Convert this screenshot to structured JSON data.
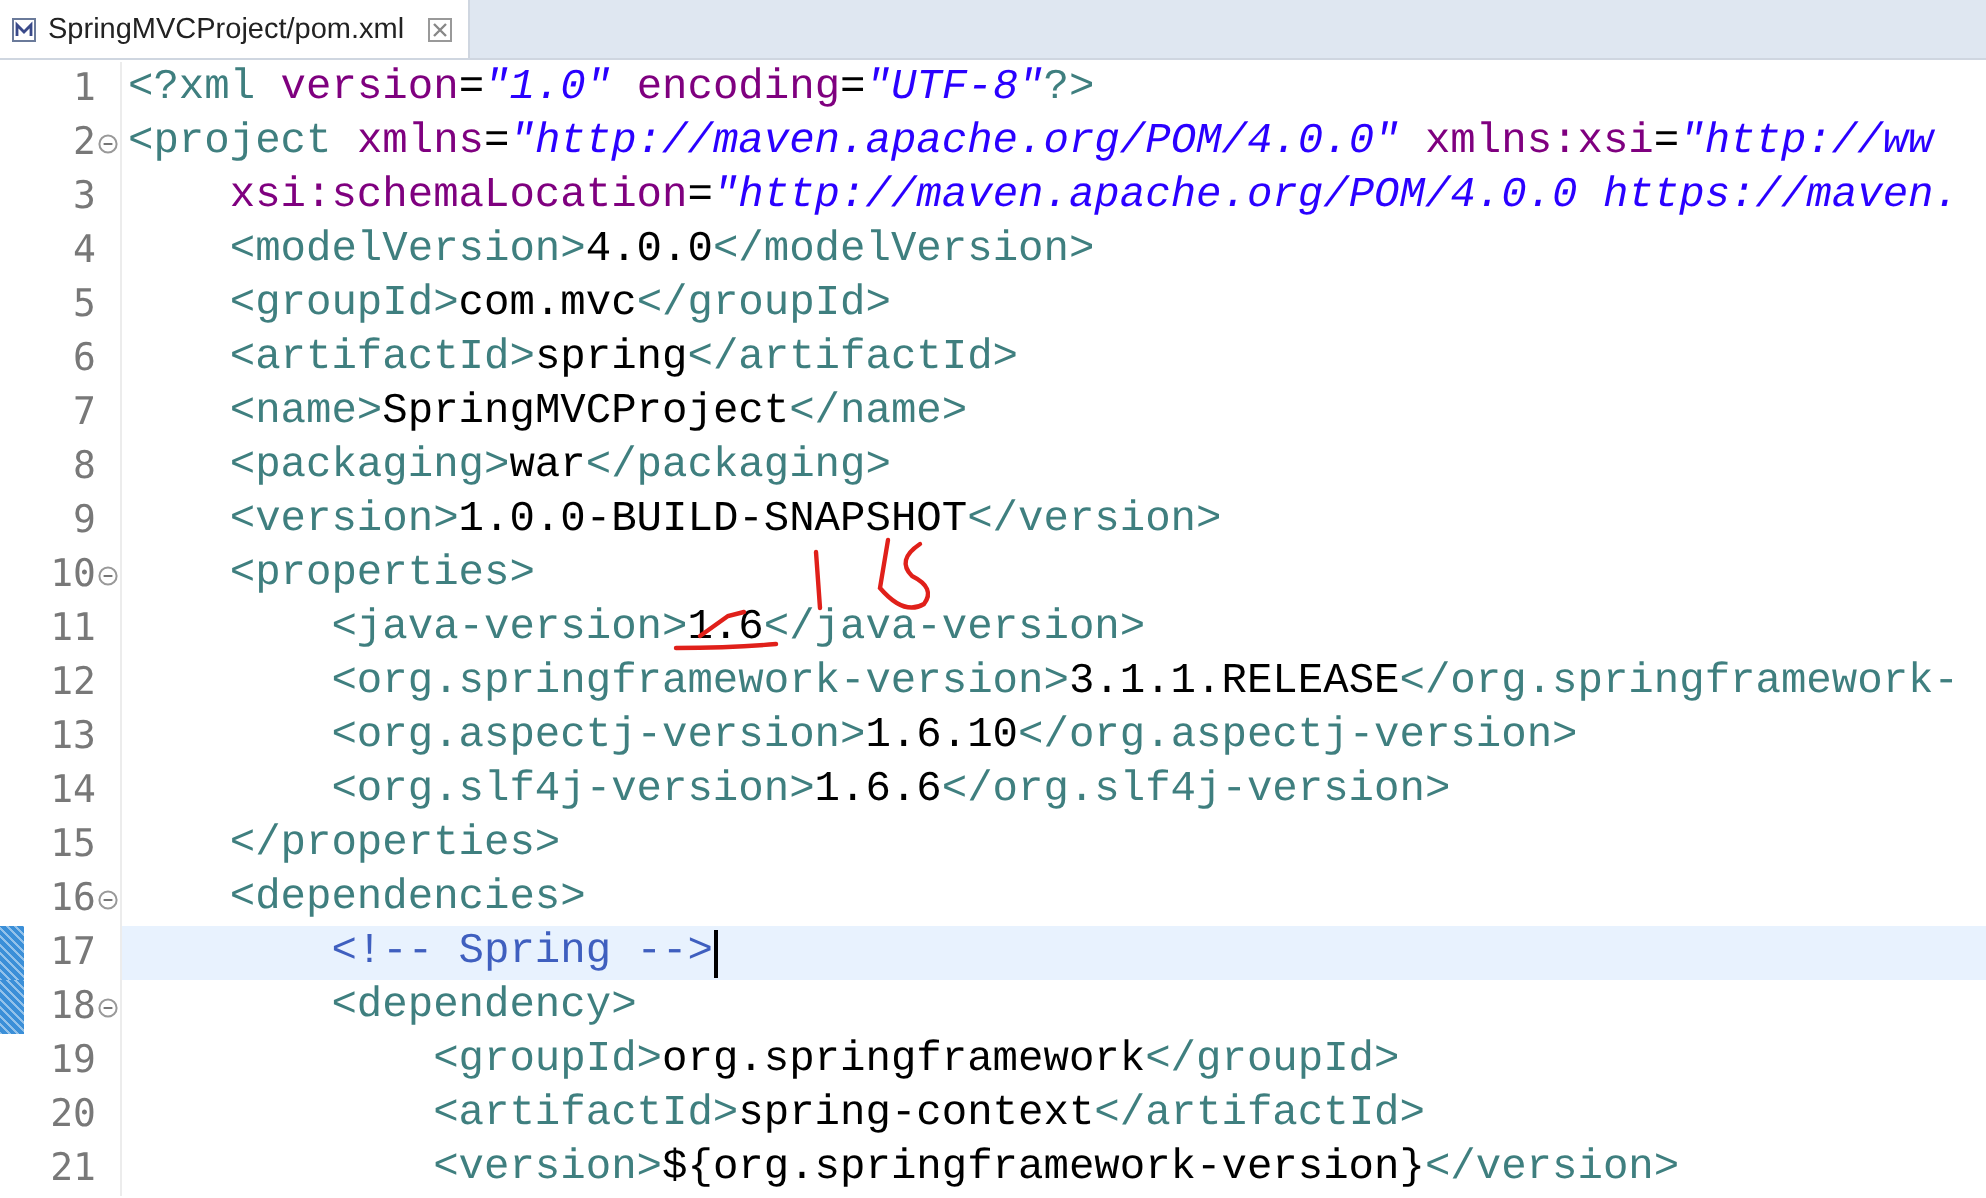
{
  "editor_tab": {
    "title": "SpringMVCProject/pom.xml",
    "selected": true
  },
  "lines": [
    {
      "number": "1",
      "fold": false,
      "current": false,
      "changed": false,
      "tokens": [
        {
          "kind": "tag",
          "text": "<?xml "
        },
        {
          "kind": "attr",
          "text": "version"
        },
        {
          "kind": "eq",
          "text": "="
        },
        {
          "kind": "value",
          "text": "\"1.0\" "
        },
        {
          "kind": "attr",
          "text": "encoding"
        },
        {
          "kind": "eq",
          "text": "="
        },
        {
          "kind": "value",
          "text": "\"UTF-8\""
        },
        {
          "kind": "tag",
          "text": "?>"
        }
      ]
    },
    {
      "number": "2",
      "fold": true,
      "current": false,
      "changed": false,
      "tokens": [
        {
          "kind": "tag",
          "text": "<project "
        },
        {
          "kind": "attr",
          "text": "xmlns"
        },
        {
          "kind": "eq",
          "text": "="
        },
        {
          "kind": "value",
          "text": "\"http://maven.apache.org/POM/4.0.0\" "
        },
        {
          "kind": "attr",
          "text": "xmlns:xsi"
        },
        {
          "kind": "eq",
          "text": "="
        },
        {
          "kind": "value",
          "text": "\"http://ww"
        }
      ]
    },
    {
      "number": "3",
      "fold": false,
      "current": false,
      "changed": false,
      "tokens": [
        {
          "kind": "attr",
          "text": "    xsi:schemaLocation"
        },
        {
          "kind": "eq",
          "text": "="
        },
        {
          "kind": "value",
          "text": "\"http://maven.apache.org/POM/4.0.0 https://maven."
        }
      ]
    },
    {
      "number": "4",
      "fold": false,
      "current": false,
      "changed": false,
      "tokens": [
        {
          "kind": "tag",
          "text": "    <modelVersion>"
        },
        {
          "kind": "text",
          "text": "4.0.0"
        },
        {
          "kind": "tag",
          "text": "</modelVersion>"
        }
      ]
    },
    {
      "number": "5",
      "fold": false,
      "current": false,
      "changed": false,
      "tokens": [
        {
          "kind": "tag",
          "text": "    <groupId>"
        },
        {
          "kind": "text",
          "text": "com.mvc"
        },
        {
          "kind": "tag",
          "text": "</groupId>"
        }
      ]
    },
    {
      "number": "6",
      "fold": false,
      "current": false,
      "changed": false,
      "tokens": [
        {
          "kind": "tag",
          "text": "    <artifactId>"
        },
        {
          "kind": "text",
          "text": "spring"
        },
        {
          "kind": "tag",
          "text": "</artifactId>"
        }
      ]
    },
    {
      "number": "7",
      "fold": false,
      "current": false,
      "changed": false,
      "tokens": [
        {
          "kind": "tag",
          "text": "    <name>"
        },
        {
          "kind": "text",
          "text": "SpringMVCProject"
        },
        {
          "kind": "tag",
          "text": "</name>"
        }
      ]
    },
    {
      "number": "8",
      "fold": false,
      "current": false,
      "changed": false,
      "tokens": [
        {
          "kind": "tag",
          "text": "    <packaging>"
        },
        {
          "kind": "text",
          "text": "war"
        },
        {
          "kind": "tag",
          "text": "</packaging>"
        }
      ]
    },
    {
      "number": "9",
      "fold": false,
      "current": false,
      "changed": false,
      "tokens": [
        {
          "kind": "tag",
          "text": "    <version>"
        },
        {
          "kind": "text",
          "text": "1.0.0-BUILD-SNAPSHOT"
        },
        {
          "kind": "tag",
          "text": "</version>"
        }
      ]
    },
    {
      "number": "10",
      "fold": true,
      "current": false,
      "changed": false,
      "tokens": [
        {
          "kind": "tag",
          "text": "    <properties>"
        }
      ]
    },
    {
      "number": "11",
      "fold": false,
      "current": false,
      "changed": false,
      "tokens": [
        {
          "kind": "tag",
          "text": "        <java-version>"
        },
        {
          "kind": "text",
          "text": "1.6"
        },
        {
          "kind": "tag",
          "text": "</java-version>"
        }
      ]
    },
    {
      "number": "12",
      "fold": false,
      "current": false,
      "changed": false,
      "tokens": [
        {
          "kind": "tag",
          "text": "        <org.springframework-version>"
        },
        {
          "kind": "text",
          "text": "3.1.1.RELEASE"
        },
        {
          "kind": "tag",
          "text": "</org.springframework-"
        }
      ]
    },
    {
      "number": "13",
      "fold": false,
      "current": false,
      "changed": false,
      "tokens": [
        {
          "kind": "tag",
          "text": "        <org.aspectj-version>"
        },
        {
          "kind": "text",
          "text": "1.6.10"
        },
        {
          "kind": "tag",
          "text": "</org.aspectj-version>"
        }
      ]
    },
    {
      "number": "14",
      "fold": false,
      "current": false,
      "changed": false,
      "tokens": [
        {
          "kind": "tag",
          "text": "        <org.slf4j-version>"
        },
        {
          "kind": "text",
          "text": "1.6.6"
        },
        {
          "kind": "tag",
          "text": "</org.slf4j-version>"
        }
      ]
    },
    {
      "number": "15",
      "fold": false,
      "current": false,
      "changed": false,
      "tokens": [
        {
          "kind": "tag",
          "text": "    </properties>"
        }
      ]
    },
    {
      "number": "16",
      "fold": true,
      "current": false,
      "changed": false,
      "tokens": [
        {
          "kind": "tag",
          "text": "    <dependencies>"
        }
      ]
    },
    {
      "number": "17",
      "fold": false,
      "current": true,
      "changed": true,
      "tokens": [
        {
          "kind": "comment",
          "text": "        <!-- Spring -->"
        }
      ]
    },
    {
      "number": "18",
      "fold": true,
      "current": false,
      "changed": true,
      "tokens": [
        {
          "kind": "tag",
          "text": "        <dependency>"
        }
      ]
    },
    {
      "number": "19",
      "fold": false,
      "current": false,
      "changed": false,
      "tokens": [
        {
          "kind": "tag",
          "text": "            <groupId>"
        },
        {
          "kind": "text",
          "text": "org.springframework"
        },
        {
          "kind": "tag",
          "text": "</groupId>"
        }
      ]
    },
    {
      "number": "20",
      "fold": false,
      "current": false,
      "changed": false,
      "tokens": [
        {
          "kind": "tag",
          "text": "            <artifactId>"
        },
        {
          "kind": "text",
          "text": "spring-context"
        },
        {
          "kind": "tag",
          "text": "</artifactId>"
        }
      ]
    },
    {
      "number": "21",
      "fold": false,
      "current": false,
      "changed": false,
      "tokens": [
        {
          "kind": "tag",
          "text": "            <version>"
        },
        {
          "kind": "text",
          "text": "${org.springframework-version}"
        },
        {
          "kind": "tag",
          "text": "</version>"
        }
      ]
    }
  ]
}
